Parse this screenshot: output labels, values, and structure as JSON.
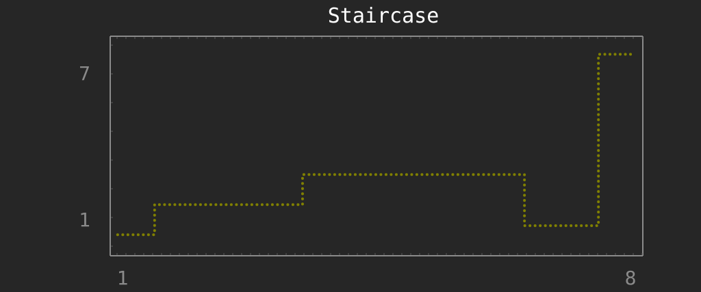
{
  "chart_data": {
    "type": "line",
    "title": "Staircase",
    "step": true,
    "x": [
      1,
      2,
      3,
      4,
      5,
      6,
      7,
      8
    ],
    "series": [
      {
        "values": [
          1,
          2,
          2,
          3,
          3,
          3,
          1.3,
          7
        ]
      }
    ],
    "xlim": [
      0.9,
      8.1
    ],
    "ylim": [
      0.3,
      7.6
    ],
    "x_ticks": [
      "1",
      "8"
    ],
    "y_ticks": [
      "1",
      "7"
    ],
    "grid": false,
    "line_color": "#808000"
  }
}
